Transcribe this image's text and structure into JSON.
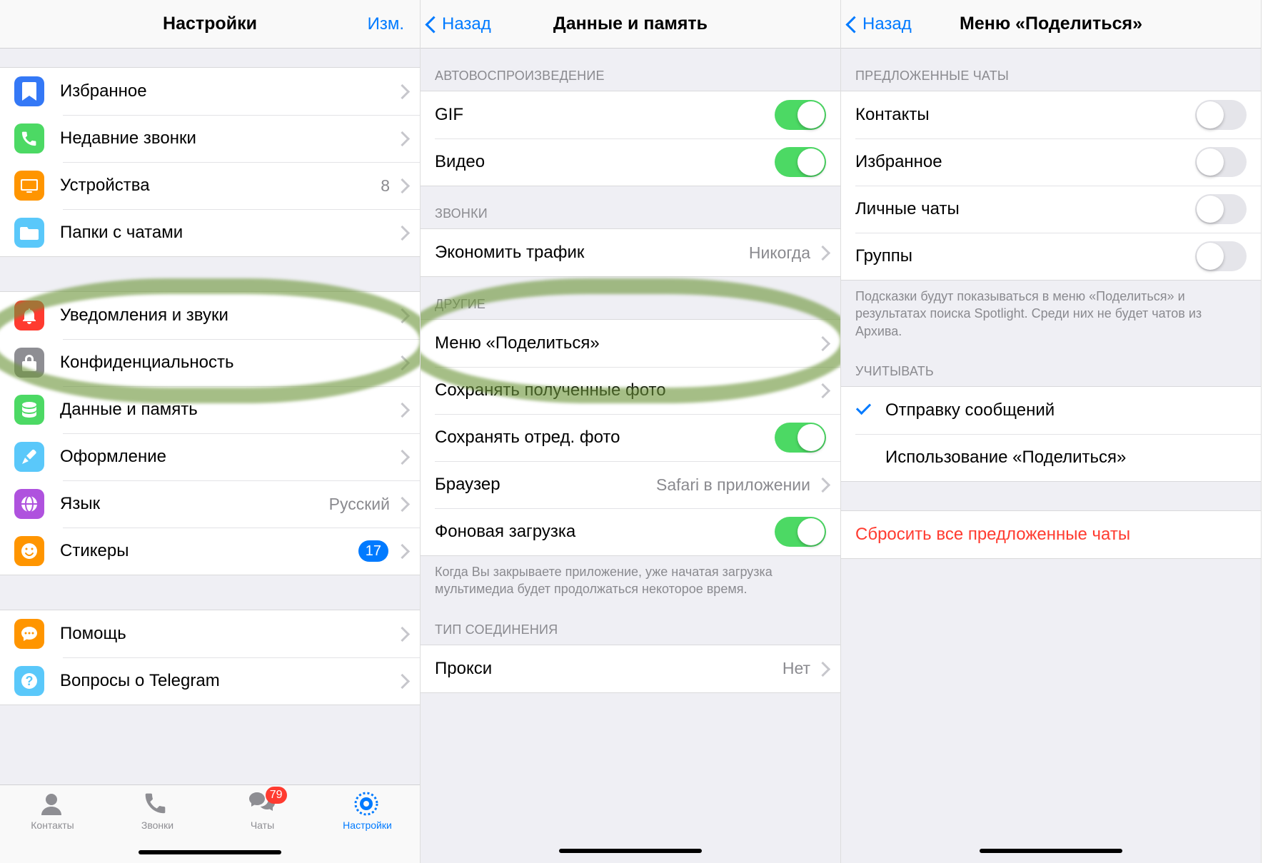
{
  "screen1": {
    "title": "Настройки",
    "edit": "Изм.",
    "group1": [
      {
        "icon": "bookmark-icon",
        "color": "#3478f6",
        "label": "Избранное"
      },
      {
        "icon": "phone-icon",
        "color": "#4cd964",
        "label": "Недавние звонки"
      },
      {
        "icon": "device-icon",
        "color": "#ff9500",
        "label": "Устройства",
        "value": "8"
      },
      {
        "icon": "folder-icon",
        "color": "#5ac8fa",
        "label": "Папки с чатами"
      }
    ],
    "group2": [
      {
        "icon": "bell-icon",
        "color": "#ff3b30",
        "label": "Уведомления и звуки"
      },
      {
        "icon": "lock-icon",
        "color": "#8e8e93",
        "label": "Конфиденциальность"
      },
      {
        "icon": "data-icon",
        "color": "#4cd964",
        "label": "Данные и память"
      },
      {
        "icon": "brush-icon",
        "color": "#5ac8fa",
        "label": "Оформление"
      },
      {
        "icon": "globe-icon",
        "color": "#af52de",
        "label": "Язык",
        "value": "Русский"
      },
      {
        "icon": "sticker-icon",
        "color": "#ff9500",
        "label": "Стикеры",
        "badge": "17"
      }
    ],
    "group3": [
      {
        "icon": "chat-icon",
        "color": "#ff9500",
        "label": "Помощь"
      },
      {
        "icon": "help-icon",
        "color": "#5ac8fa",
        "label": "Вопросы о Telegram"
      }
    ],
    "tabs": {
      "contacts": "Контакты",
      "calls": "Звонки",
      "chats": "Чаты",
      "chats_badge": "79",
      "settings": "Настройки"
    }
  },
  "screen2": {
    "back": "Назад",
    "title": "Данные и память",
    "autoplay_header": "АВТОВОСПРОИЗВЕДЕНИЕ",
    "gif": "GIF",
    "video": "Видео",
    "calls_header": "ЗВОНКИ",
    "save_data": "Экономить трафик",
    "save_data_value": "Никогда",
    "other_header": "ДРУГИЕ",
    "share_menu": "Меню «Поделиться»",
    "save_received": "Сохранять полученные фото",
    "save_edited": "Сохранять отред. фото",
    "browser": "Браузер",
    "browser_value": "Safari в приложении",
    "bg_download": "Фоновая загрузка",
    "bg_footer": "Когда Вы закрываете приложение, уже начатая загрузка мультимедиа будет продолжаться некоторое время.",
    "conn_header": "ТИП СОЕДИНЕНИЯ",
    "proxy": "Прокси",
    "proxy_value": "Нет"
  },
  "screen3": {
    "back": "Назад",
    "title": "Меню «Поделиться»",
    "suggested_header": "ПРЕДЛОЖЕННЫЕ ЧАТЫ",
    "contacts": "Контакты",
    "favorites": "Избранное",
    "private": "Личные чаты",
    "groups": "Группы",
    "suggested_footer": "Подсказки будут показываться в меню «Поделиться» и результатах поиска Spotlight. Среди них не будет чатов из Архива.",
    "consider_header": "УЧИТЫВАТЬ",
    "send_msgs": "Отправку сообщений",
    "use_share": "Использование «Поделиться»",
    "reset": "Сбросить все предложенные чаты"
  }
}
